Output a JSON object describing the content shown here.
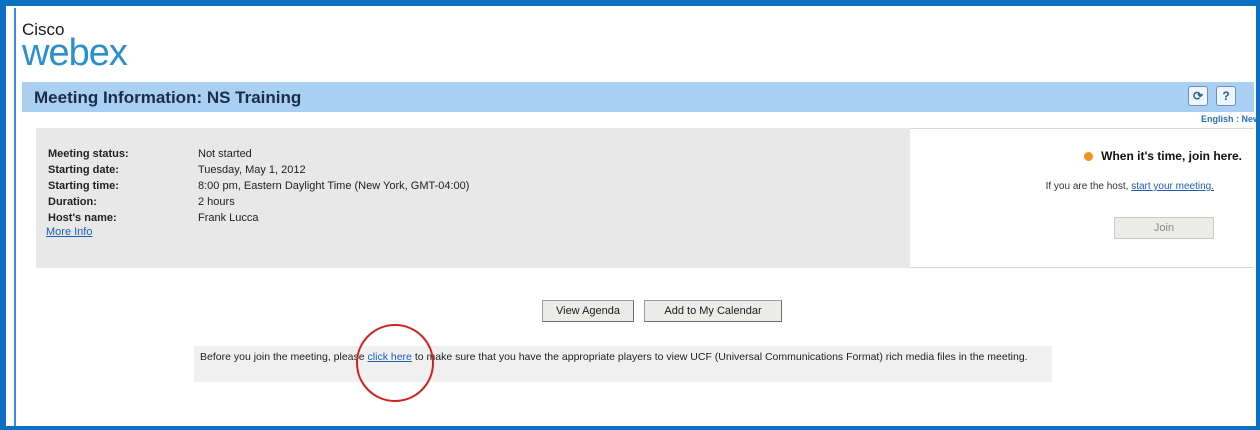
{
  "logo": {
    "cisco": "Cisco",
    "webex": "webex"
  },
  "header": {
    "title": "Meeting Information: NS Training",
    "lang_link": "English : New"
  },
  "meeting": {
    "rows": [
      {
        "label": "Meeting status:",
        "value": "Not started"
      },
      {
        "label": "Starting date:",
        "value": "Tuesday, May 1, 2012"
      },
      {
        "label": "Starting time:",
        "value": "8:00 pm, Eastern Daylight Time (New York, GMT-04:00)"
      },
      {
        "label": "Duration:",
        "value": "2 hours"
      },
      {
        "label": "Host's name:",
        "value": "Frank Lucca"
      }
    ],
    "more_info": "More Info"
  },
  "join": {
    "heading": "When it's time, join here.",
    "host_prefix": "If you are the host,",
    "host_link": "start your meeting.",
    "join_button": "Join"
  },
  "actions": {
    "view_agenda": "View Agenda",
    "add_calendar": "Add to My Calendar"
  },
  "notice": {
    "before": "Before you join the meeting, please",
    "link": "click here",
    "after": "to make sure that you have the appropriate players to view UCF (Universal Communications Format) rich media files in the meeting."
  },
  "colors": {
    "frame": "#0b6fc4",
    "title_bar": "#a9cff3",
    "highlight_circle": "#d0211c",
    "status_dot": "#f0941f"
  }
}
